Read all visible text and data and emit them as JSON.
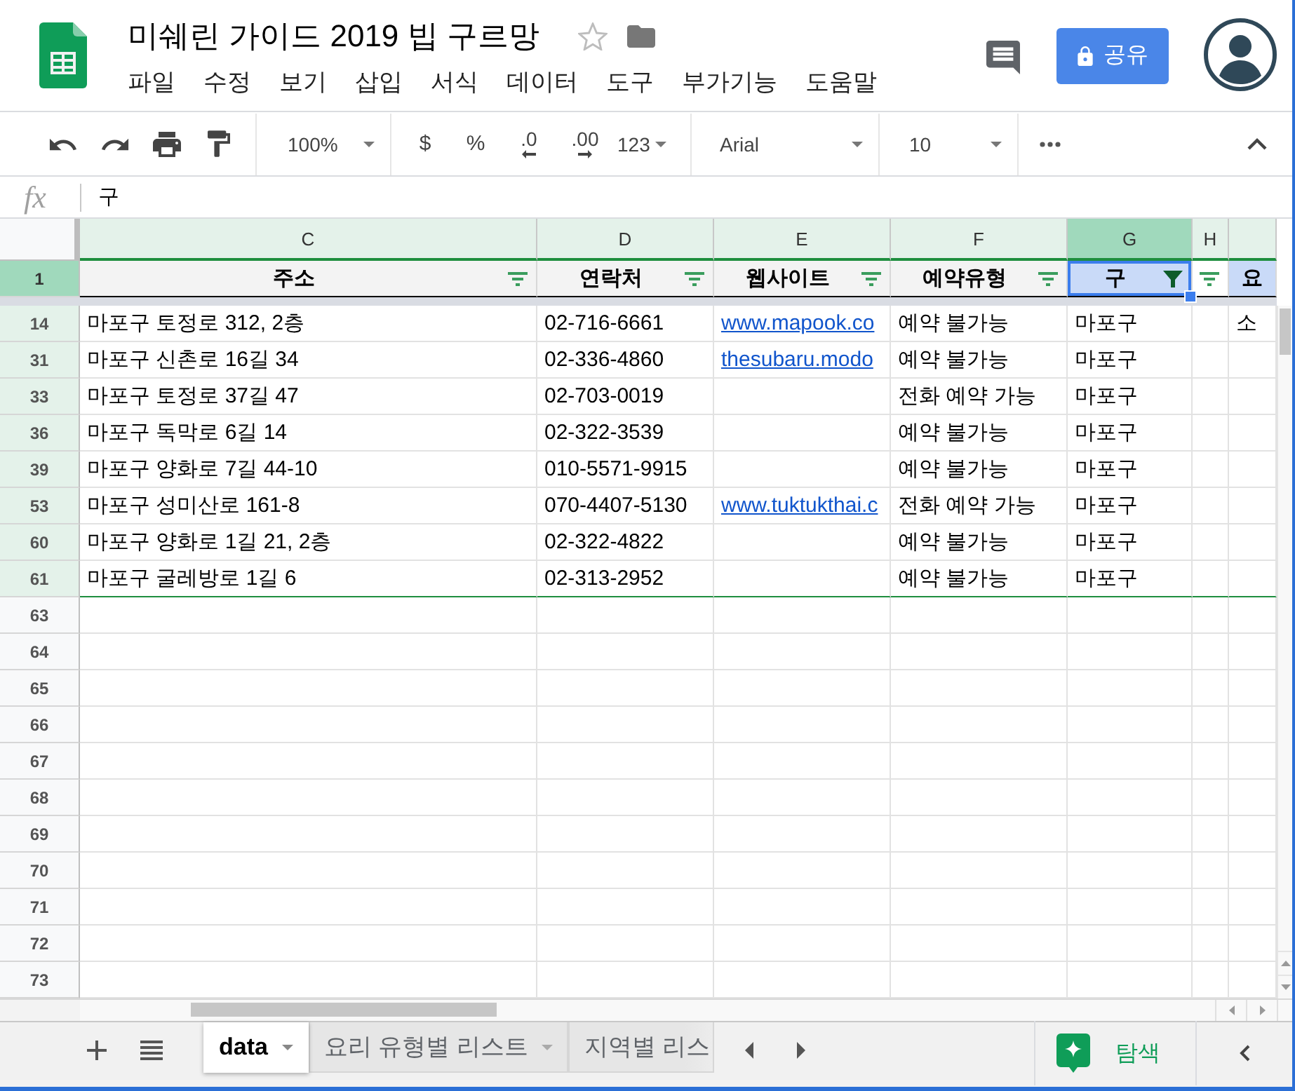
{
  "document": {
    "title": "미쉐린 가이드 2019 빕 구르망",
    "starred": false
  },
  "menu": [
    "파일",
    "수정",
    "보기",
    "삽입",
    "서식",
    "데이터",
    "도구",
    "부가기능",
    "도움말"
  ],
  "share_button": {
    "label": "공유"
  },
  "toolbar": {
    "zoom": "100%",
    "currency": "$",
    "percent": "%",
    "decimal_decrease": ".0",
    "decimal_increase": ".00",
    "number_format": "123",
    "font": "Arial",
    "font_size": "10"
  },
  "formula_bar": {
    "label": "fx",
    "value": "구"
  },
  "columns": [
    {
      "letter": "C",
      "selected": false,
      "in_filter": true
    },
    {
      "letter": "D",
      "selected": false,
      "in_filter": true
    },
    {
      "letter": "E",
      "selected": false,
      "in_filter": true
    },
    {
      "letter": "F",
      "selected": false,
      "in_filter": true
    },
    {
      "letter": "G",
      "selected": true,
      "in_filter": true
    },
    {
      "letter": "H",
      "selected": false,
      "in_filter": true
    },
    {
      "selected": false,
      "in_filter": true
    }
  ],
  "header_row": {
    "number": "1",
    "selected": true,
    "cells": [
      {
        "text": "주소",
        "filter_button": true,
        "filtered": false,
        "selected": false,
        "color": "#f3f3f3"
      },
      {
        "text": "연락처",
        "filter_button": true,
        "filtered": false,
        "selected": false,
        "color": "#f3f3f3"
      },
      {
        "text": "웹사이트",
        "filter_button": true,
        "filtered": false,
        "selected": false,
        "color": "#f3f3f3"
      },
      {
        "text": "예약유형",
        "filter_button": true,
        "filtered": false,
        "selected": false,
        "color": "#f3f3f3"
      },
      {
        "text": "구",
        "filter_button": true,
        "filtered": true,
        "selected": true,
        "color": "#c9daf8"
      },
      {
        "filter_button": true,
        "filtered": false,
        "selected": false
      },
      {
        "text": "요",
        "selected": false,
        "color": "#c9daf8"
      }
    ]
  },
  "rows": [
    {
      "number": "14",
      "in_filter": true,
      "cells": {
        "address": "마포구 토정로 312, 2층",
        "phone": "02-716-6661",
        "website": "www.mapook.co",
        "reservation_type": "예약 불가능",
        "district": "마포구",
        "column_i": "소"
      }
    },
    {
      "number": "31",
      "in_filter": true,
      "cells": {
        "address": "마포구 신촌로 16길 34",
        "phone": "02-336-4860",
        "website": "thesubaru.modo",
        "reservation_type": "예약 불가능",
        "district": "마포구"
      }
    },
    {
      "number": "33",
      "in_filter": true,
      "cells": {
        "address": "마포구 토정로 37길 47",
        "phone": "02-703-0019",
        "reservation_type": "전화 예약 가능",
        "district": "마포구"
      }
    },
    {
      "number": "36",
      "in_filter": true,
      "cells": {
        "address": "마포구 독막로 6길 14",
        "phone": "02-322-3539",
        "reservation_type": "예약 불가능",
        "district": "마포구"
      }
    },
    {
      "number": "39",
      "in_filter": true,
      "cells": {
        "address": "마포구 양화로 7길 44-10",
        "phone": "010-5571-9915",
        "reservation_type": "예약 불가능",
        "district": "마포구"
      }
    },
    {
      "number": "53",
      "in_filter": true,
      "cells": {
        "address": "마포구 성미산로 161-8",
        "phone": "070-4407-5130",
        "website": "www.tuktukthai.c",
        "reservation_type": "전화 예약 가능",
        "district": "마포구"
      }
    },
    {
      "number": "60",
      "in_filter": true,
      "cells": {
        "address": "마포구 양화로 1길 21, 2층",
        "phone": "02-322-4822",
        "reservation_type": "예약 불가능",
        "district": "마포구"
      }
    },
    {
      "number": "61",
      "in_filter": true,
      "cells": {
        "address": "마포구 굴레방로 1길 6",
        "phone": "02-313-2952",
        "reservation_type": "예약 불가능",
        "district": "마포구"
      }
    },
    {
      "number": "63",
      "in_filter": false
    },
    {
      "number": "64",
      "in_filter": false
    },
    {
      "number": "65",
      "in_filter": false
    },
    {
      "number": "66",
      "in_filter": false
    },
    {
      "number": "67",
      "in_filter": false
    },
    {
      "number": "68",
      "in_filter": false
    },
    {
      "number": "69",
      "in_filter": false
    },
    {
      "number": "70",
      "in_filter": false
    },
    {
      "number": "71",
      "in_filter": false
    },
    {
      "number": "72",
      "in_filter": false
    },
    {
      "number": "73",
      "in_filter": false
    }
  ],
  "sheet_tabs": [
    {
      "label": "data",
      "selected": true,
      "cut_off": false
    },
    {
      "label": "요리 유형별 리스트",
      "selected": false,
      "cut_off": false
    },
    {
      "label": "지역별 리스",
      "selected": false,
      "cut_off": true
    }
  ],
  "explore_button": {
    "label": "탐색"
  }
}
